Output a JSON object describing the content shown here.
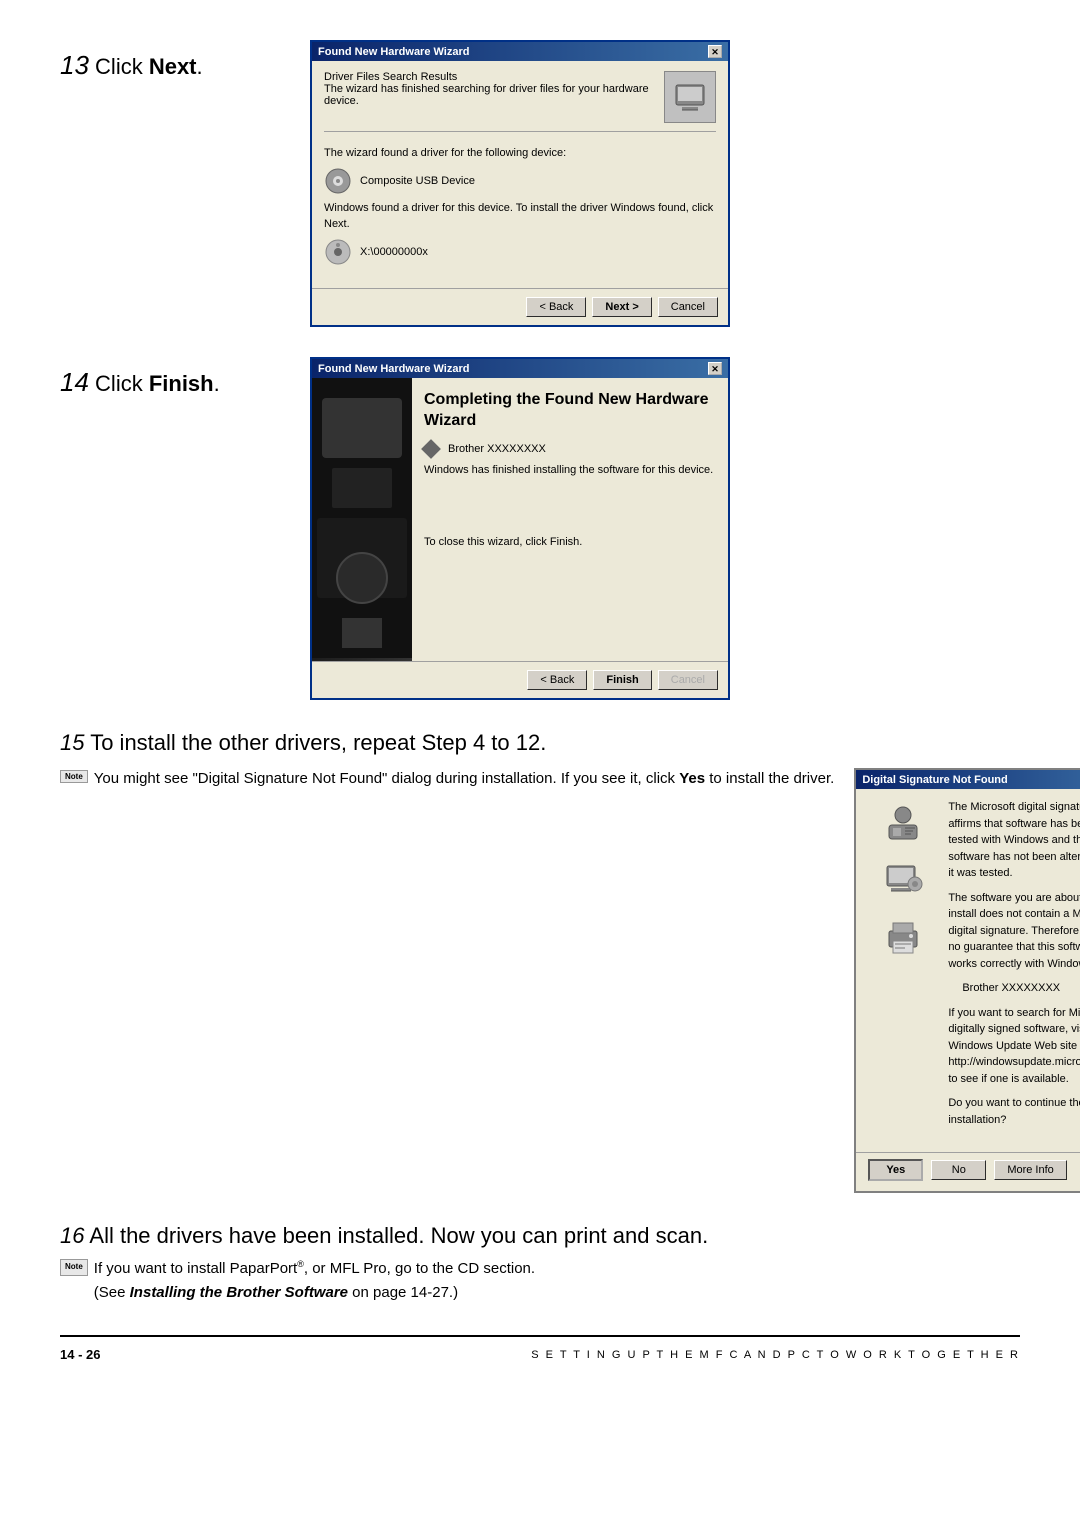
{
  "steps": {
    "step13": {
      "number": "13",
      "instruction": "Click ",
      "bold": "Next",
      "dialog": {
        "title": "Found New Hardware Wizard",
        "header_title": "Driver Files Search Results",
        "header_subtitle": "The wizard has finished searching for driver files for your hardware device.",
        "body1": "The wizard found a driver for the following device:",
        "device_name": "Composite USB Device",
        "body2": "Windows found a driver for this device. To install the driver Windows found, click Next.",
        "driver_path": "X:\\00000000x",
        "btn_back": "< Back",
        "btn_next": "Next >",
        "btn_cancel": "Cancel"
      }
    },
    "step14": {
      "number": "14",
      "instruction": "Click ",
      "bold": "Finish",
      "dialog": {
        "title": "Found New Hardware Wizard",
        "completing_title": "Completing the Found New Hardware Wizard",
        "device_name": "Brother XXXXXXXX",
        "body1": "Windows has finished installing the software for this device.",
        "body2": "To close this wizard, click Finish.",
        "btn_back": "< Back",
        "btn_finish": "Finish",
        "btn_cancel": "Cancel"
      }
    },
    "step15": {
      "number": "15",
      "instruction": "To install the other drivers, repeat Step 4 to 12.",
      "note_badge": "Note",
      "note_text1": "You might see \"Digital Signature Not Found\" dialog during installation. If you see it, click ",
      "note_bold": "Yes",
      "note_text2": " to install the driver.",
      "sig_dialog": {
        "title": "Digital Signature Not Found",
        "close_btn": "x",
        "body1": "The Microsoft digital signature affirms that software has been tested with Windows and that the software has not been altered since it was tested.",
        "body2": "The software you are about to install does not contain a Microsoft digital signature. Therefore,  there is no guarantee that this software works correctly with Windows.",
        "device_name": "Brother XXXXXXXX",
        "body3": "If you want to search for Microsoft digitally signed software, visit the Windows Update Web site at http://windowsupdate.microsoft.com to see if one is available.",
        "body4": "Do you want to continue the installation?",
        "btn_yes": "Yes",
        "btn_no": "No",
        "btn_more_info": "More Info"
      }
    },
    "step16": {
      "number": "16",
      "instruction": "All the drivers have been installed. Now you can print and scan.",
      "note_badge": "Note",
      "note_text": "If you want to install PaparPort",
      "note_trademark": "®",
      "note_text2": ", or MFL Pro, go to the CD section.",
      "note_italic": "(See ",
      "note_italic_bold": "Installing the Brother Software",
      "note_italic2": " on page 14-27.)"
    }
  },
  "footer": {
    "page": "14 - 26",
    "text": "S E T T I N G   U P   T H E   M F C   A N D   P C   T O   W O R K   T O G E T H E R"
  }
}
